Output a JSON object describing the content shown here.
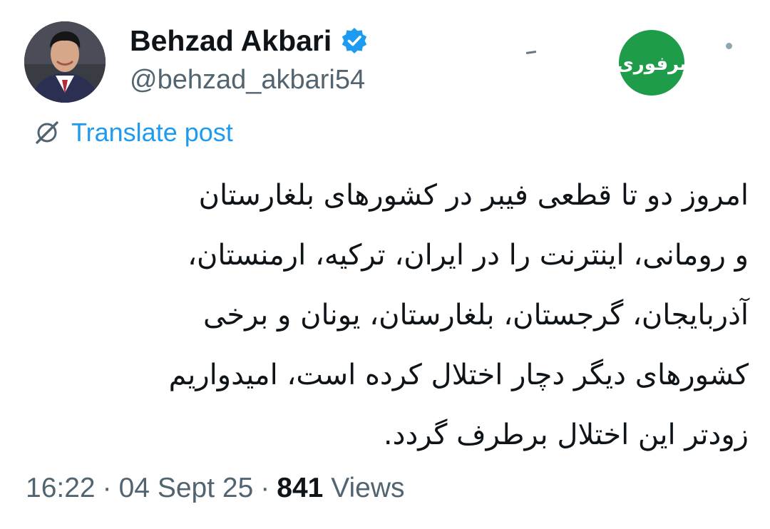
{
  "author": {
    "display_name": "Behzad Akbari",
    "handle": "@behzad_akbari54",
    "avatar_icon": "profile-photo",
    "verified_icon": "verified-badge-icon",
    "verified_color": "#1d9bf0"
  },
  "header": {
    "brand_logo_icon": "green-circle-logo",
    "brand_logo_text": "برفوری",
    "brand_color": "#1f9c4a",
    "more_icon": "dot-icon"
  },
  "translate": {
    "icon": "globe-slash-icon",
    "label": "Translate post",
    "color": "#1d9bf0"
  },
  "post": {
    "lines": [
      "امروز دو تا قطعی فیبر در کشورهای بلغارستان",
      "و رومانی، اینترنت را در ایران، ترکیه، ارمنستان،",
      "آذربایجان، گرجستان، بلغارستان، یونان و برخی",
      "کشورهای دیگر دچار اختلال کرده است، امیدواریم",
      "زودتر این اختلال برطرف گردد."
    ]
  },
  "meta": {
    "time": "16:22",
    "separator": "·",
    "date": "04 Sept 25",
    "views_count": "841",
    "views_label": "Views"
  }
}
